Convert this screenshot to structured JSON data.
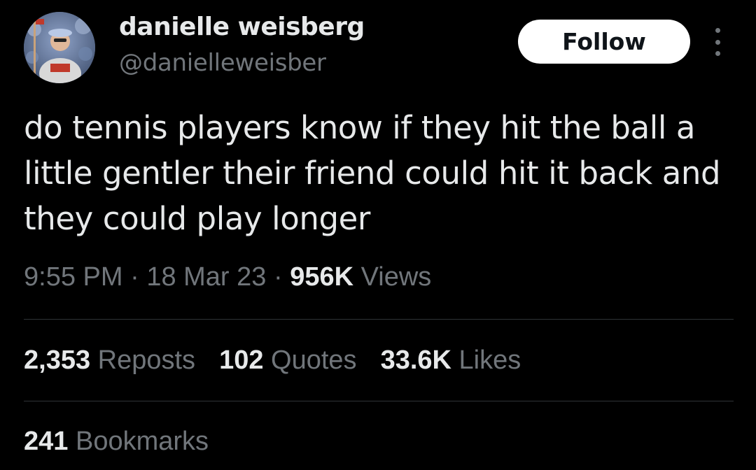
{
  "author": {
    "display_name": "danielle weisberg",
    "handle": "@danielleweisber"
  },
  "follow_button": {
    "label": "Follow"
  },
  "more_icon": "more-vertical-icon",
  "tweet": {
    "text": "do tennis players know if they hit the ball a\nlittle gentler their friend could hit it back and\nthey could play longer",
    "time": "9:55 PM",
    "date": "18 Mar 23",
    "separator": "·",
    "views_count": "956K",
    "views_label": "Views"
  },
  "stats": {
    "reposts_count": "2,353",
    "reposts_label": "Reposts",
    "quotes_count": "102",
    "quotes_label": "Quotes",
    "likes_count": "33.6K",
    "likes_label": "Likes",
    "bookmarks_count": "241",
    "bookmarks_label": "Bookmarks"
  },
  "colors": {
    "background": "#000000",
    "primary_text": "#e7e9ea",
    "secondary_text": "#71767b",
    "divider": "#2f3336",
    "follow_bg": "#ffffff"
  }
}
